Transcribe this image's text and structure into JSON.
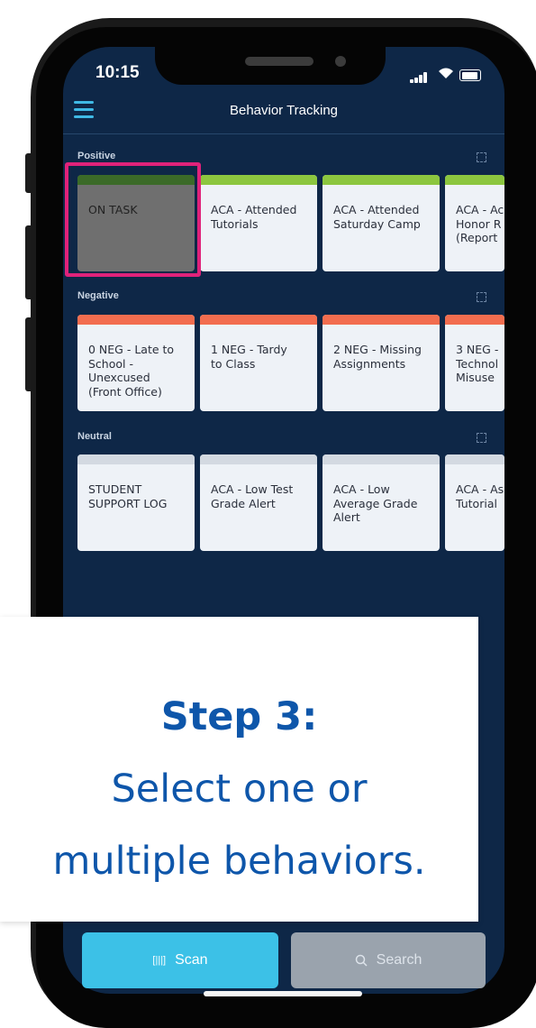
{
  "status_bar": {
    "time": "10:15"
  },
  "header": {
    "title": "Behavior Tracking",
    "menu_icon": "hamburger-icon"
  },
  "sections": [
    {
      "label": "Positive",
      "kind": "pos",
      "cards": [
        "ON TASK",
        "ACA - Attended Tutorials",
        "ACA - Attended Saturday Camp",
        "ACA - Ac\nHonor R\n(Report"
      ]
    },
    {
      "label": "Negative",
      "kind": "neg",
      "cards": [
        "0 NEG - Late to\nSchool -\nUnexcused\n(Front Office)",
        "1 NEG - Tardy\nto Class",
        "2 NEG - Missing\nAssignments",
        "3 NEG -\nTechnol\nMisuse"
      ]
    },
    {
      "label": "Neutral",
      "kind": "neu",
      "cards": [
        "STUDENT\nSUPPORT LOG",
        "ACA - Low Test\nGrade Alert",
        "ACA - Low\nAverage Grade\nAlert",
        "ACA - As\nTutorial"
      ]
    }
  ],
  "selected_card": "ON TASK",
  "bottom": {
    "scan_label": "Scan",
    "search_label": "Search"
  },
  "overlay": {
    "step": "Step 3:",
    "line1": "Select one or",
    "line2": "multiple behaviors."
  },
  "colors": {
    "background": "#0e2747",
    "positive": "#8cc63f",
    "negative": "#f26d4f",
    "neutral": "#d3d9e1",
    "accent": "#3cc1e7",
    "highlight": "#e0227a",
    "text_blue": "#0e56aa"
  }
}
